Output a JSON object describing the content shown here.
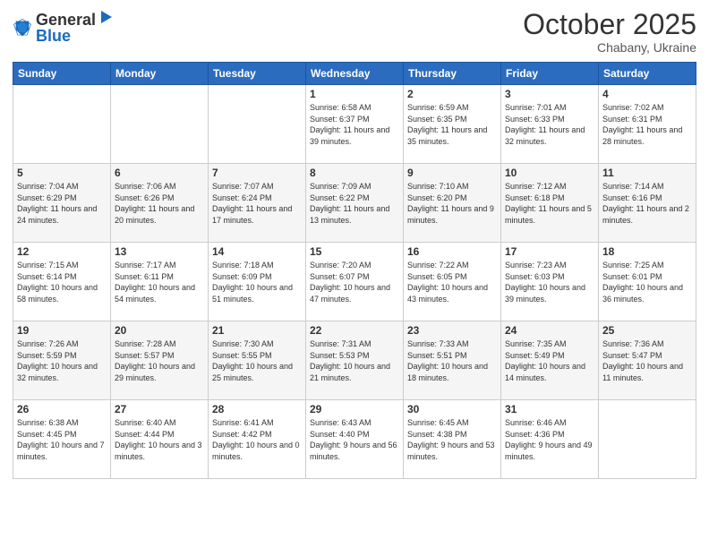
{
  "header": {
    "logo_general": "General",
    "logo_blue": "Blue",
    "month": "October 2025",
    "location": "Chabany, Ukraine"
  },
  "days_of_week": [
    "Sunday",
    "Monday",
    "Tuesday",
    "Wednesday",
    "Thursday",
    "Friday",
    "Saturday"
  ],
  "weeks": [
    [
      {
        "day": "",
        "sunrise": "",
        "sunset": "",
        "daylight": ""
      },
      {
        "day": "",
        "sunrise": "",
        "sunset": "",
        "daylight": ""
      },
      {
        "day": "",
        "sunrise": "",
        "sunset": "",
        "daylight": ""
      },
      {
        "day": "1",
        "sunrise": "Sunrise: 6:58 AM",
        "sunset": "Sunset: 6:37 PM",
        "daylight": "Daylight: 11 hours and 39 minutes."
      },
      {
        "day": "2",
        "sunrise": "Sunrise: 6:59 AM",
        "sunset": "Sunset: 6:35 PM",
        "daylight": "Daylight: 11 hours and 35 minutes."
      },
      {
        "day": "3",
        "sunrise": "Sunrise: 7:01 AM",
        "sunset": "Sunset: 6:33 PM",
        "daylight": "Daylight: 11 hours and 32 minutes."
      },
      {
        "day": "4",
        "sunrise": "Sunrise: 7:02 AM",
        "sunset": "Sunset: 6:31 PM",
        "daylight": "Daylight: 11 hours and 28 minutes."
      }
    ],
    [
      {
        "day": "5",
        "sunrise": "Sunrise: 7:04 AM",
        "sunset": "Sunset: 6:29 PM",
        "daylight": "Daylight: 11 hours and 24 minutes."
      },
      {
        "day": "6",
        "sunrise": "Sunrise: 7:06 AM",
        "sunset": "Sunset: 6:26 PM",
        "daylight": "Daylight: 11 hours and 20 minutes."
      },
      {
        "day": "7",
        "sunrise": "Sunrise: 7:07 AM",
        "sunset": "Sunset: 6:24 PM",
        "daylight": "Daylight: 11 hours and 17 minutes."
      },
      {
        "day": "8",
        "sunrise": "Sunrise: 7:09 AM",
        "sunset": "Sunset: 6:22 PM",
        "daylight": "Daylight: 11 hours and 13 minutes."
      },
      {
        "day": "9",
        "sunrise": "Sunrise: 7:10 AM",
        "sunset": "Sunset: 6:20 PM",
        "daylight": "Daylight: 11 hours and 9 minutes."
      },
      {
        "day": "10",
        "sunrise": "Sunrise: 7:12 AM",
        "sunset": "Sunset: 6:18 PM",
        "daylight": "Daylight: 11 hours and 5 minutes."
      },
      {
        "day": "11",
        "sunrise": "Sunrise: 7:14 AM",
        "sunset": "Sunset: 6:16 PM",
        "daylight": "Daylight: 11 hours and 2 minutes."
      }
    ],
    [
      {
        "day": "12",
        "sunrise": "Sunrise: 7:15 AM",
        "sunset": "Sunset: 6:14 PM",
        "daylight": "Daylight: 10 hours and 58 minutes."
      },
      {
        "day": "13",
        "sunrise": "Sunrise: 7:17 AM",
        "sunset": "Sunset: 6:11 PM",
        "daylight": "Daylight: 10 hours and 54 minutes."
      },
      {
        "day": "14",
        "sunrise": "Sunrise: 7:18 AM",
        "sunset": "Sunset: 6:09 PM",
        "daylight": "Daylight: 10 hours and 51 minutes."
      },
      {
        "day": "15",
        "sunrise": "Sunrise: 7:20 AM",
        "sunset": "Sunset: 6:07 PM",
        "daylight": "Daylight: 10 hours and 47 minutes."
      },
      {
        "day": "16",
        "sunrise": "Sunrise: 7:22 AM",
        "sunset": "Sunset: 6:05 PM",
        "daylight": "Daylight: 10 hours and 43 minutes."
      },
      {
        "day": "17",
        "sunrise": "Sunrise: 7:23 AM",
        "sunset": "Sunset: 6:03 PM",
        "daylight": "Daylight: 10 hours and 39 minutes."
      },
      {
        "day": "18",
        "sunrise": "Sunrise: 7:25 AM",
        "sunset": "Sunset: 6:01 PM",
        "daylight": "Daylight: 10 hours and 36 minutes."
      }
    ],
    [
      {
        "day": "19",
        "sunrise": "Sunrise: 7:26 AM",
        "sunset": "Sunset: 5:59 PM",
        "daylight": "Daylight: 10 hours and 32 minutes."
      },
      {
        "day": "20",
        "sunrise": "Sunrise: 7:28 AM",
        "sunset": "Sunset: 5:57 PM",
        "daylight": "Daylight: 10 hours and 29 minutes."
      },
      {
        "day": "21",
        "sunrise": "Sunrise: 7:30 AM",
        "sunset": "Sunset: 5:55 PM",
        "daylight": "Daylight: 10 hours and 25 minutes."
      },
      {
        "day": "22",
        "sunrise": "Sunrise: 7:31 AM",
        "sunset": "Sunset: 5:53 PM",
        "daylight": "Daylight: 10 hours and 21 minutes."
      },
      {
        "day": "23",
        "sunrise": "Sunrise: 7:33 AM",
        "sunset": "Sunset: 5:51 PM",
        "daylight": "Daylight: 10 hours and 18 minutes."
      },
      {
        "day": "24",
        "sunrise": "Sunrise: 7:35 AM",
        "sunset": "Sunset: 5:49 PM",
        "daylight": "Daylight: 10 hours and 14 minutes."
      },
      {
        "day": "25",
        "sunrise": "Sunrise: 7:36 AM",
        "sunset": "Sunset: 5:47 PM",
        "daylight": "Daylight: 10 hours and 11 minutes."
      }
    ],
    [
      {
        "day": "26",
        "sunrise": "Sunrise: 6:38 AM",
        "sunset": "Sunset: 4:45 PM",
        "daylight": "Daylight: 10 hours and 7 minutes."
      },
      {
        "day": "27",
        "sunrise": "Sunrise: 6:40 AM",
        "sunset": "Sunset: 4:44 PM",
        "daylight": "Daylight: 10 hours and 3 minutes."
      },
      {
        "day": "28",
        "sunrise": "Sunrise: 6:41 AM",
        "sunset": "Sunset: 4:42 PM",
        "daylight": "Daylight: 10 hours and 0 minutes."
      },
      {
        "day": "29",
        "sunrise": "Sunrise: 6:43 AM",
        "sunset": "Sunset: 4:40 PM",
        "daylight": "Daylight: 9 hours and 56 minutes."
      },
      {
        "day": "30",
        "sunrise": "Sunrise: 6:45 AM",
        "sunset": "Sunset: 4:38 PM",
        "daylight": "Daylight: 9 hours and 53 minutes."
      },
      {
        "day": "31",
        "sunrise": "Sunrise: 6:46 AM",
        "sunset": "Sunset: 4:36 PM",
        "daylight": "Daylight: 9 hours and 49 minutes."
      },
      {
        "day": "",
        "sunrise": "",
        "sunset": "",
        "daylight": ""
      }
    ]
  ]
}
